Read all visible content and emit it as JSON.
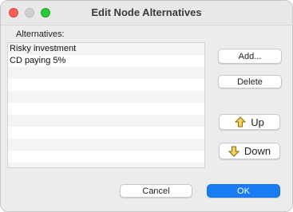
{
  "window": {
    "title": "Edit Node Alternatives"
  },
  "alternatives": {
    "label": "Alternatives:",
    "items": [
      "Risky investment",
      "CD paying 5%",
      "",
      "",
      "",
      "",
      "",
      "",
      "",
      "",
      ""
    ]
  },
  "buttons": {
    "add": "Add...",
    "delete": "Delete",
    "up": "Up",
    "down": "Down",
    "cancel": "Cancel",
    "ok": "OK"
  },
  "icons": {
    "up": "arrow-up-icon",
    "down": "arrow-down-icon",
    "close": "close-icon",
    "minimize": "minimize-icon",
    "maximize": "maximize-icon"
  },
  "colors": {
    "accent": "#1a7cf2",
    "arrow_fill": "#f5d05c"
  }
}
